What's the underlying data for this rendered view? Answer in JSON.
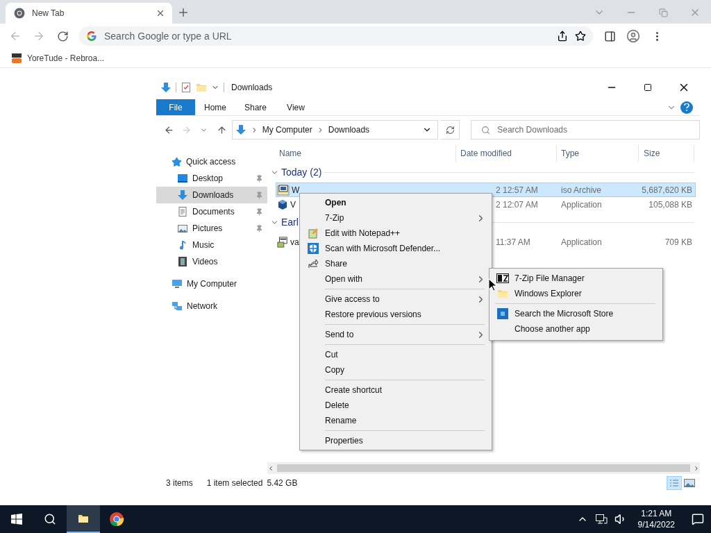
{
  "browser": {
    "tab": {
      "title": "New Tab",
      "selected": true
    },
    "omnibox": {
      "placeholder": "Search Google or type a URL"
    },
    "bookmarks": [
      {
        "label": "YoreTude - Rebroa..."
      }
    ]
  },
  "explorer": {
    "title": "Downloads",
    "ribbon_tabs": [
      {
        "label": "File",
        "selected": true
      },
      {
        "label": "Home",
        "selected": false
      },
      {
        "label": "Share",
        "selected": false
      },
      {
        "label": "View",
        "selected": false
      }
    ],
    "breadcrumb": [
      "My Computer",
      "Downloads"
    ],
    "search": {
      "placeholder": "Search Downloads"
    },
    "nav": [
      {
        "label": "Quick access",
        "selected": false,
        "children": [
          {
            "label": "Desktop",
            "selected": false,
            "pinned": true
          },
          {
            "label": "Downloads",
            "selected": true,
            "pinned": true
          },
          {
            "label": "Documents",
            "selected": false,
            "pinned": true
          },
          {
            "label": "Pictures",
            "selected": false,
            "pinned": true
          },
          {
            "label": "Music",
            "selected": false,
            "pinned": false
          },
          {
            "label": "Videos",
            "selected": false,
            "pinned": false
          }
        ]
      },
      {
        "label": "My Computer",
        "selected": false
      },
      {
        "label": "Network",
        "selected": false
      }
    ],
    "columns": [
      "Name",
      "Date modified",
      "Type",
      "Size"
    ],
    "groups": [
      {
        "label": "Today (2)",
        "rows": [
          {
            "name": "W",
            "date": "2 12:57 AM",
            "type": "iso Archive",
            "size": "5,687,620 KB",
            "selected": true
          },
          {
            "name": "V",
            "date": "2 12:07 AM",
            "type": "Application",
            "size": "105,088 KB",
            "selected": false
          }
        ]
      },
      {
        "label": "Earl",
        "rows": [
          {
            "name": "va",
            "date": "11:37 AM",
            "type": "Application",
            "size": "709 KB",
            "selected": false
          }
        ]
      }
    ],
    "status": {
      "count": "3 items",
      "selection": "1 item selected",
      "size": "5.42 GB"
    },
    "view_buttons": [
      {
        "selected": true
      },
      {
        "selected": false
      }
    ],
    "context_menu": {
      "items": [
        {
          "kind": "item",
          "label": "Open",
          "default": true,
          "submenu": false
        },
        {
          "kind": "item",
          "label": "7-Zip",
          "default": false,
          "submenu": true
        },
        {
          "kind": "item",
          "label": "Edit with Notepad++",
          "default": false,
          "submenu": false
        },
        {
          "kind": "item",
          "label": "Scan with Microsoft Defender...",
          "default": false,
          "submenu": false
        },
        {
          "kind": "item",
          "label": "Share",
          "default": false,
          "submenu": false
        },
        {
          "kind": "item",
          "label": "Open with",
          "default": false,
          "submenu": true
        },
        {
          "kind": "separator"
        },
        {
          "kind": "item",
          "label": "Give access to",
          "default": false,
          "submenu": true
        },
        {
          "kind": "item",
          "label": "Restore previous versions",
          "default": false,
          "submenu": false
        },
        {
          "kind": "separator"
        },
        {
          "kind": "item",
          "label": "Send to",
          "default": false,
          "submenu": true
        },
        {
          "kind": "separator"
        },
        {
          "kind": "item",
          "label": "Cut",
          "default": false,
          "submenu": false
        },
        {
          "kind": "item",
          "label": "Copy",
          "default": false,
          "submenu": false
        },
        {
          "kind": "separator"
        },
        {
          "kind": "item",
          "label": "Create shortcut",
          "default": false,
          "submenu": false
        },
        {
          "kind": "item",
          "label": "Delete",
          "default": false,
          "submenu": false
        },
        {
          "kind": "item",
          "label": "Rename",
          "default": false,
          "submenu": false
        },
        {
          "kind": "separator"
        },
        {
          "kind": "item",
          "label": "Properties",
          "default": false,
          "submenu": false
        }
      ]
    },
    "submenu": {
      "items": [
        {
          "kind": "item",
          "label": "7-Zip File Manager"
        },
        {
          "kind": "item",
          "label": "Windows Explorer"
        },
        {
          "kind": "separator"
        },
        {
          "kind": "item",
          "label": "Search the Microsoft Store"
        },
        {
          "kind": "item",
          "label": "Choose another app"
        }
      ]
    }
  },
  "taskbar": {
    "apps": [
      {
        "active": false
      },
      {
        "active": false
      },
      {
        "active": true
      },
      {
        "active": false
      }
    ],
    "time": "1:21 AM",
    "date": "9/14/2022"
  }
}
